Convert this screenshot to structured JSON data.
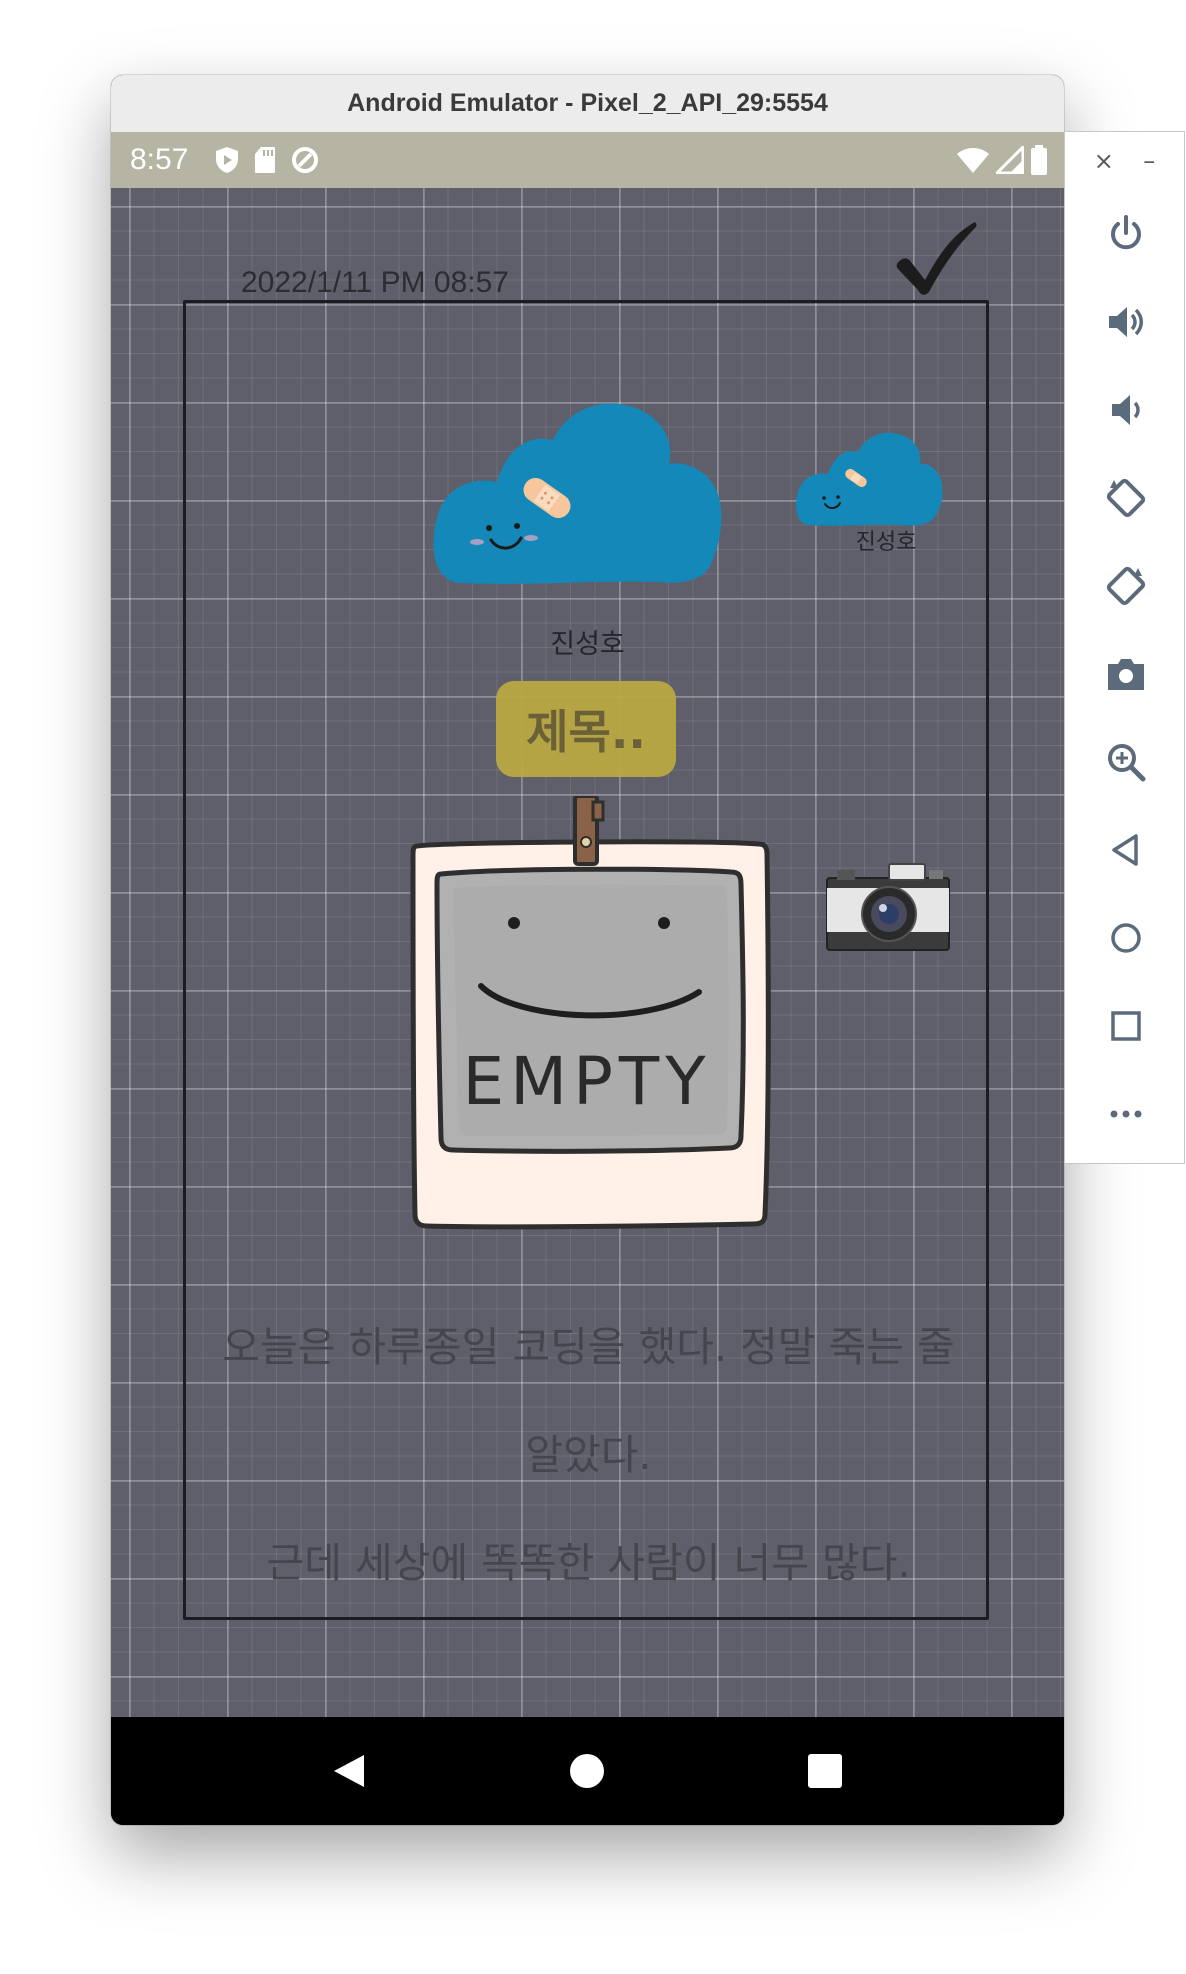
{
  "window": {
    "title": "Android Emulator - Pixel_2_API_29:5554"
  },
  "statusbar": {
    "time": "8:57"
  },
  "diary": {
    "datetime": "2022/1/11 PM 08:57",
    "author_big": "진성호",
    "author_small": "진성호",
    "title_placeholder": "제목..",
    "photo_placeholder": "EMPTY",
    "content_lines": [
      "오늘은 하루종일 코딩을 했다. 정말 죽는 줄",
      "알았다.",
      "근데 세상에 똑똑한 사람이 너무 많다."
    ]
  },
  "colors": {
    "statusbar": "#b6b5a3",
    "background": "#5f5f6b",
    "cloud": "#1488b8",
    "title_box": "#bdaa40",
    "polaroid_frame": "#fff1e8",
    "polaroid_inner": "#b1b1b1"
  },
  "icons": {
    "status_left": [
      "play-protect-icon",
      "sd-card-icon",
      "sync-icon"
    ],
    "status_right": [
      "wifi-icon",
      "signal-icon",
      "battery-icon"
    ],
    "nav": [
      "back-icon",
      "home-icon",
      "recents-icon"
    ],
    "side_panel": [
      "power-icon",
      "volume-up-icon",
      "volume-down-icon",
      "rotate-left-icon",
      "rotate-right-icon",
      "screenshot-icon",
      "zoom-icon",
      "back-icon",
      "home-icon",
      "overview-icon",
      "more-icon"
    ]
  },
  "side_panel": {
    "close": "×",
    "minimize": "–"
  }
}
